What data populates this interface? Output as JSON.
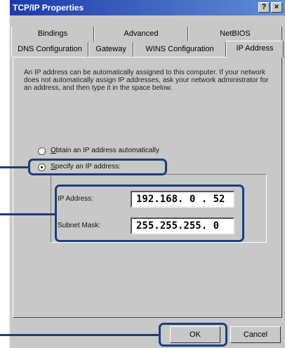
{
  "window": {
    "title": "TCP/IP Properties",
    "help_glyph": "?",
    "close_glyph": "×"
  },
  "tabs_back": [
    "Bindings",
    "Advanced",
    "NetBIOS"
  ],
  "tabs_front": [
    "DNS Configuration",
    "Gateway",
    "WINS Configuration",
    "IP Address"
  ],
  "active_tab": "IP Address",
  "description": "An IP address can be automatically assigned to this computer. If your network does not automatically assign IP addresses, ask your network administrator for an address, and then type it in the space below.",
  "options": {
    "obtain": {
      "label_ul": "O",
      "label_rest": "btain an IP address automatically",
      "selected": false
    },
    "specify": {
      "label_ul": "S",
      "label_rest": "pecify an IP address:",
      "selected": true
    }
  },
  "fields": {
    "ip_label": "IP Address:",
    "ip_value": "192.168. 0 . 52",
    "mask_label": "Subnet Mask:",
    "mask_value": "255.255.255. 0"
  },
  "buttons": {
    "ok": "OK",
    "cancel": "Cancel"
  },
  "colors": {
    "highlight": "#1a3f7a",
    "titlebar": "#1c3aa9",
    "face": "#c8c8c8"
  }
}
